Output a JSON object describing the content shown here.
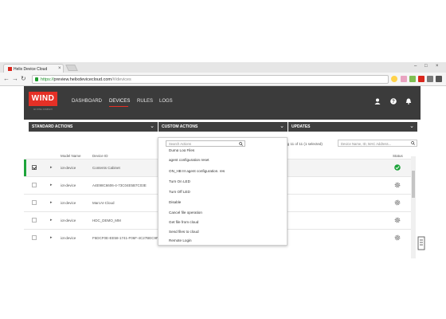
{
  "browser": {
    "tab_title": "Helix Device Cloud",
    "tab_close": "×",
    "window_controls": {
      "minimize": "–",
      "maximize": "□",
      "close": "×"
    },
    "nav": {
      "back": "←",
      "forward": "→",
      "reload": "↻"
    },
    "url": {
      "scheme": "https://",
      "host": "preview.helixdevicecloud.com",
      "path": "/#/devices"
    }
  },
  "app": {
    "logo": "WIND",
    "logo_sub": "AN INTEL COMPANY",
    "nav": [
      {
        "label": "DASHBOARD"
      },
      {
        "label": "DEVICES"
      },
      {
        "label": "RULES"
      },
      {
        "label": "LOGS"
      }
    ],
    "header_icons": [
      "user-icon",
      "help-icon",
      "bell-icon"
    ]
  },
  "actions": {
    "standard": "STANDARD ACTIONS",
    "custom": "CUSTOM ACTIONS",
    "updates": "UPDATES"
  },
  "table": {
    "filter_info": "ving 11 of 11 (1 selected)",
    "search_placeholder": "Device Name, ID, MAC Address...",
    "columns": {
      "model": "Model Name",
      "device_id": "Device ID",
      "status": "Status"
    },
    "rows": [
      {
        "model": "iot-device",
        "device_id": "Contents Cabinet",
        "extra": "",
        "status": "ok",
        "selected": true
      },
      {
        "model": "iot-device",
        "device_id": "A4E98C6606-4-73C04E5B7C03E",
        "extra": "",
        "status": "gear",
        "selected": false
      },
      {
        "model": "iot-device",
        "device_id": "MarcAI-Cloud",
        "extra": "",
        "status": "gear",
        "selected": false
      },
      {
        "model": "iot-device",
        "device_id": "HDC_DEMO_MM",
        "extra": "",
        "status": "gear",
        "selected": false
      },
      {
        "model": "iot-device",
        "device_id": "F5DCF0E-EE58-1741-F06F-4C27BEC9F4FF",
        "extra": "NSB2-9B32EF1A9",
        "extra2": "wrhold-70834",
        "status": "gear",
        "selected": false
      }
    ]
  },
  "dropdown": {
    "search_placeholder": "Search Actions",
    "items": [
      "Dump Log Files",
      "agent configuration reset",
      "ON_HB III agent configuration. res",
      "Turn On LED",
      "Turn Off LED",
      "Disable",
      "Cancel file operation",
      "Get file from cloud",
      "Send files to cloud",
      "Remote Login"
    ]
  },
  "colors": {
    "header_bg": "#3b3b3b",
    "brand_red": "#e53026",
    "status_ok": "#1ea43b",
    "action_bar": "#3f3f3f"
  }
}
